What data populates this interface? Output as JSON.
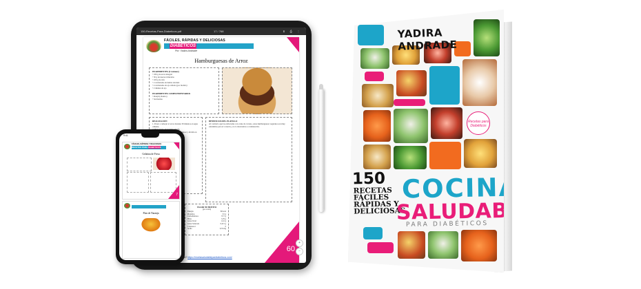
{
  "tablet": {
    "toolbar": {
      "file_name": "150-Recetas-Para-Diabeticos.pdf",
      "page_indicator": "17 / 768"
    },
    "header": {
      "tagline": "FÁCILES, RÁPIDAS Y DELICIOSAS",
      "title_main": "RECETAS PARA",
      "title_highlight": "DIABÉTICOS",
      "author_line": "Por: Yadira Andrade"
    },
    "recipe_title": "Hamburguesas de Arroz",
    "ingredients": {
      "heading": "INGREDIENTES (4 raciones)",
      "items": [
        "180 g de arroz integral",
        "50 g de nueces trituradas",
        "100 g de tofu",
        "2 cucharadas de harina de maíz",
        "4 cucharadas de ajo rallado (por molido)",
        "2 dientes de ajo"
      ]
    },
    "complementary": {
      "heading": "INGREDIENTES COMPLEMENTARIOS",
      "items": [
        "Perejil (cilantro)",
        "Sal marina"
      ]
    },
    "preparation": {
      "heading": "REALIZACIÓN",
      "items": [
        "Poner a remojar el arroz durante 30 minutos en agua caliente.",
        "Picar el ajo, el perejil y el tofu.",
        "Mezclar todos los ingredientes, amasar y dividir en porciones."
      ]
    },
    "benefits": {
      "heading": "BENEFICIOS DEL PLATILLO",
      "text": "Al contrario que las elaboradas con carne de vacuno, estas hamburguesas vegetales son muy saludables para el corazón, y te lo mostramos a continuación."
    },
    "nutrition": {
      "heading": "VALOR NUTRITIVO",
      "subheading": "(por ración)",
      "rows": [
        {
          "label": "Energía",
          "value": "80 kcal"
        },
        {
          "label": "Proteínas",
          "value": "3,5 g"
        },
        {
          "label": "Carbohidratos",
          "value": "37,7 g"
        },
        {
          "label": "Fibra",
          "value": "3,76 g"
        },
        {
          "label": "Grasa Total",
          "value": "14,5 g"
        },
        {
          "label": "Grasa Saturada",
          "value": "0,215 g"
        },
        {
          "label": "Colesterol",
          "value": "0"
        },
        {
          "label": "Sodio",
          "value": "9,76 mg"
        }
      ]
    },
    "page_number": "60",
    "footer_link": "https://recetasaludablepardiabeticos.com/",
    "footer_link_prefix": "¿Más recetas?"
  },
  "phone": {
    "status_time": "9:41",
    "header_tagline": "FÁCILES, RÁPIDAS Y DELICIOSAS",
    "title_main": "RECETAS PARA",
    "title_highlight": "DIABÉTICOS",
    "recipe_title": "Gelatina de Fresa",
    "second_recipe_title": "Flan de Naranja",
    "page_number": "7"
  },
  "book": {
    "author": "YADIRA ANDRADE",
    "count": "150",
    "subtitle_lines": [
      "RECETAS",
      "FÁCILES",
      "RÁPIDAS Y",
      "DELICIOSAS"
    ],
    "title_line1": "COCINA",
    "title_line2": "SALUDABLE",
    "title_line3": "PARA DIABÉTICOS",
    "badge_text": "Recetas para Diabéticos",
    "colors": {
      "cyan": "#1da5c9",
      "pink": "#e91d78",
      "orange": "#f26b1f"
    }
  }
}
